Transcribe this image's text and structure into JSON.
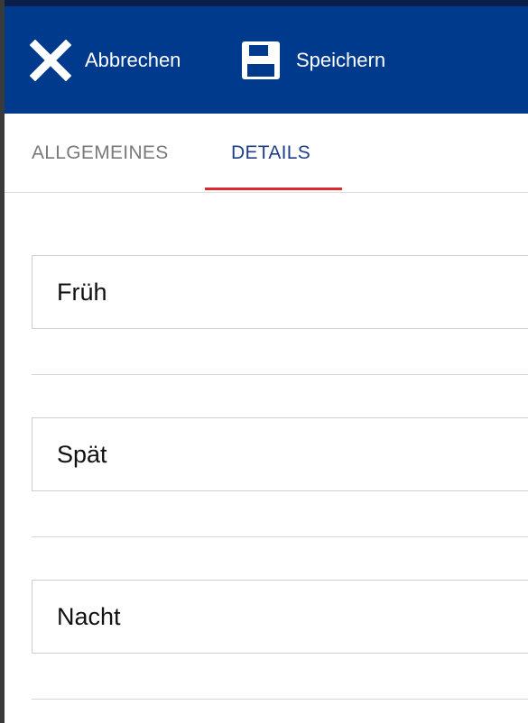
{
  "toolbar": {
    "cancel_label": "Abbrechen",
    "cancel_icon": "close-icon",
    "save_label": "Speichern",
    "save_icon": "floppy-disk-icon",
    "background_color": "#003a8c"
  },
  "tabs": [
    {
      "label": "ALLGEMEINES",
      "active": false
    },
    {
      "label": "DETAILS",
      "active": true
    }
  ],
  "active_tab_indicator_color": "#e0282e",
  "fields": [
    {
      "value": "Früh"
    },
    {
      "value": "Spät"
    },
    {
      "value": "Nacht"
    }
  ]
}
